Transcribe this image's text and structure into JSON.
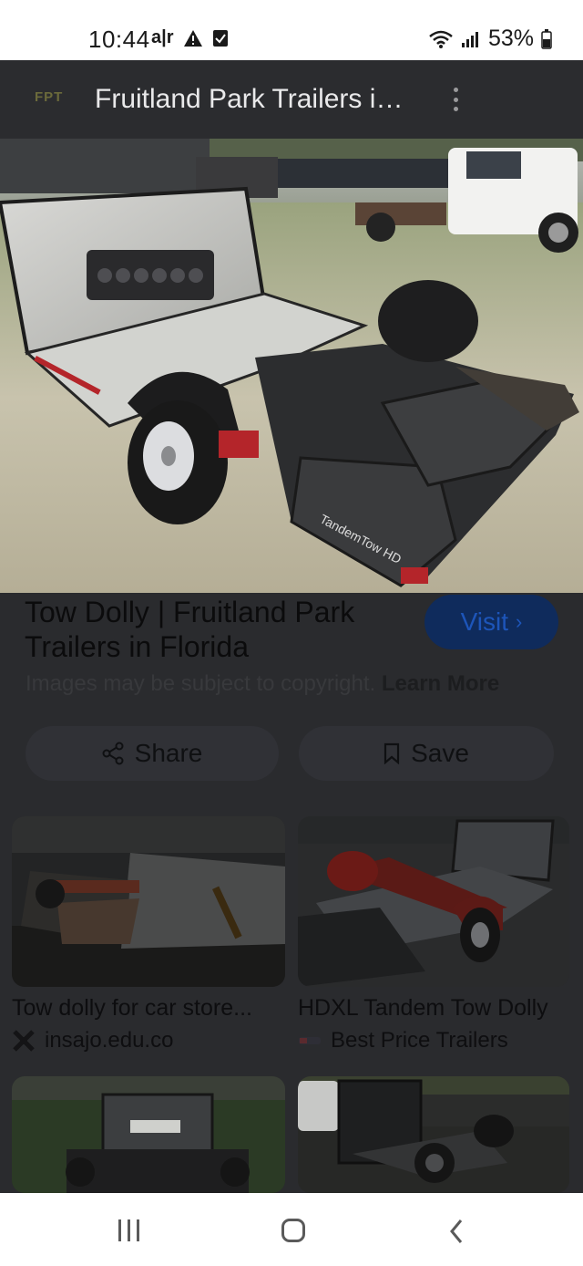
{
  "status_bar": {
    "time": "10:44",
    "carrier_glyph": "a|r",
    "battery": "53%"
  },
  "header": {
    "site_logo_text": "FPT",
    "title": "Fruitland Park Trailers in Florida"
  },
  "result": {
    "title": "Tow Dolly | Fruitland Park Trailers in Florida",
    "visit_label": "Visit",
    "copyright_text": "Images may be subject to copyright.",
    "learn_more": "Learn More"
  },
  "actions": {
    "share_label": "Share",
    "save_label": "Save"
  },
  "hero_image": {
    "brand_text": "TandemTow HD"
  },
  "related": [
    {
      "caption": "Tow dolly for car store...",
      "source": "insajo.edu.co",
      "source_icon": "cross-logo-icon"
    },
    {
      "caption": "HDXL Tandem Tow Dolly",
      "source": "Best Price Trailers",
      "source_icon": "trailer-logo-icon"
    }
  ],
  "colors": {
    "overlay_bg": "#2a2b2e",
    "visit_button_bg": "#0f2b5c",
    "visit_button_text": "#1d55b9"
  }
}
